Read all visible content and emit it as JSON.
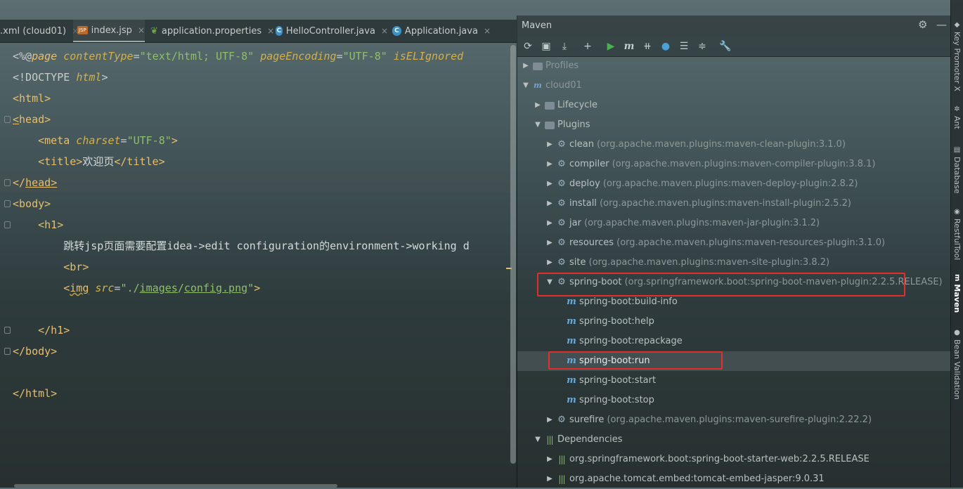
{
  "tabs": [
    {
      "label": ".xml (cloud01)",
      "icon": "xml-file-icon"
    },
    {
      "label": "index.jsp",
      "icon": "jsp-file-icon",
      "active": true
    },
    {
      "label": "application.properties",
      "icon": "properties-leaf-icon"
    },
    {
      "label": "HelloController.java",
      "icon": "java-class-icon"
    },
    {
      "label": "Application.java",
      "icon": "java-class-icon"
    }
  ],
  "code": {
    "l1_a": "<%@",
    "l1_b": "page",
    "l1_c": " contentType",
    "l1_d": "=",
    "l1_e": "\"text/html; UTF-8\"",
    "l1_f": " pageEncoding",
    "l1_g": "=",
    "l1_h": "\"UTF-8\"",
    "l1_i": " isELIgnored",
    "l2_a": "<!DOCTYPE ",
    "l2_b": "html",
    "l2_c": ">",
    "l3": "<html>",
    "l4_a": "<",
    "l4_b": "head",
    "l4_c": ">",
    "l5_a": "    <meta",
    "l5_b": " charset",
    "l5_c": "=",
    "l5_d": "\"UTF-8\"",
    "l5_e": ">",
    "l6_a": "    <title>",
    "l6_b": "欢迎页",
    "l6_c": "</title>",
    "l7_a": "</",
    "l7_b": "head",
    "l7_c": ">",
    "l8": "<body>",
    "l9": "    <h1>",
    "l10": "        跳转jsp页面需要配置idea->edit configuration的environment->working d",
    "l11": "        <br>",
    "l12_a": "        <",
    "l12_b": "img",
    "l12_c": " src",
    "l12_d": "=",
    "l12_e": "\"./",
    "l12_f": "images",
    "l12_g": "/",
    "l12_h": "config.png",
    "l12_i": "\"",
    "l12_j": ">",
    "l14": "    </h1>",
    "l15": "</body>",
    "l17": "</html>"
  },
  "maven": {
    "title": "Maven",
    "toolbar_icons": [
      "reload-icon",
      "generate-sources-icon",
      "download-icon",
      "add-icon",
      "run-icon",
      "execute-goal-icon",
      "toggle-offline-icon",
      "skip-tests-icon",
      "show-dependencies-icon",
      "collapse-all-icon",
      "settings-wrench-icon"
    ],
    "tree": {
      "profiles": "Profiles",
      "project": "cloud01",
      "lifecycle": "Lifecycle",
      "plugins": "Plugins",
      "plugin_list": [
        {
          "name": "clean",
          "coord": "(org.apache.maven.plugins:maven-clean-plugin:3.1.0)"
        },
        {
          "name": "compiler",
          "coord": "(org.apache.maven.plugins:maven-compiler-plugin:3.8.1)"
        },
        {
          "name": "deploy",
          "coord": "(org.apache.maven.plugins:maven-deploy-plugin:2.8.2)"
        },
        {
          "name": "install",
          "coord": "(org.apache.maven.plugins:maven-install-plugin:2.5.2)"
        },
        {
          "name": "jar",
          "coord": "(org.apache.maven.plugins:maven-jar-plugin:3.1.2)"
        },
        {
          "name": "resources",
          "coord": "(org.apache.maven.plugins:maven-resources-plugin:3.1.0)"
        },
        {
          "name": "site",
          "coord": "(org.apache.maven.plugins:maven-site-plugin:3.8.2)"
        },
        {
          "name": "spring-boot",
          "coord": "(org.springframework.boot:spring-boot-maven-plugin:2.2.5.RELEASE)"
        }
      ],
      "goals": [
        "spring-boot:build-info",
        "spring-boot:help",
        "spring-boot:repackage",
        "spring-boot:run",
        "spring-boot:start",
        "spring-boot:stop"
      ],
      "surefire": {
        "name": "surefire",
        "coord": "(org.apache.maven.plugins:maven-surefire-plugin:2.22.2)"
      },
      "dependencies": "Dependencies",
      "dep_list": [
        "org.springframework.boot:spring-boot-starter-web:2.2.5.RELEASE",
        "org.apache.tomcat.embed:tomcat-embed-jasper:9.0.31"
      ]
    }
  },
  "right_tools": [
    "Key Promoter X",
    "Ant",
    "Database",
    "RestfulTool",
    "Maven",
    "Bean Validation"
  ],
  "colors": {
    "highlight_box": "#e0302c",
    "tag": "#e8bf6a",
    "string": "#8fbf6a",
    "attribute": "#d4b04a"
  }
}
